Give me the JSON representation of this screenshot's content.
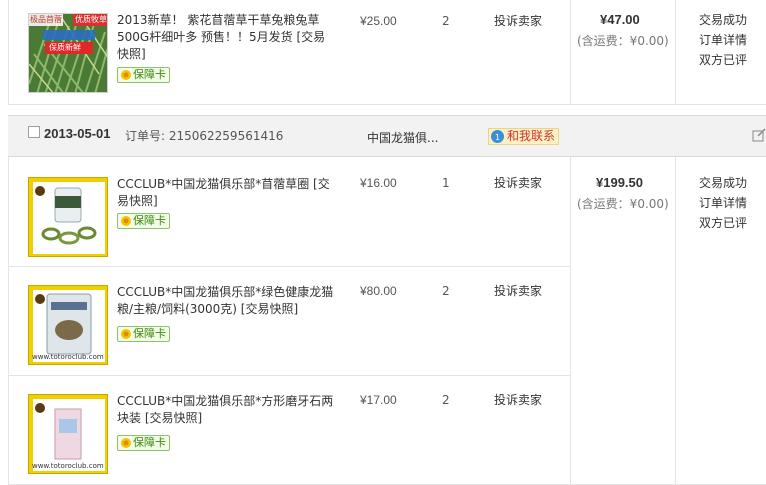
{
  "orders": [
    {
      "items": [
        {
          "title": "2013新草！ 紫花苜蓿草干草兔粮兔草500G杆细叶多 预售！！5月发货 [交易快照]",
          "image_text": [
            "极品苜蓿",
            "优质牧草",
            "保质新鲜"
          ],
          "badge": "保障卡",
          "price": "¥25.00",
          "qty": "2",
          "complain": "投诉卖家"
        }
      ],
      "total": "¥47.00",
      "shipping": "(含运费：¥0.00)",
      "status": [
        "交易成功",
        "订单详情",
        "双方已评"
      ]
    },
    {
      "header": {
        "date": "2013-05-01",
        "order_label": "订单号: 215062259561416",
        "seller": "中国龙猫俱...",
        "contact": "和我联系"
      },
      "items": [
        {
          "title": "CCCLUB*中国龙猫俱乐部*苜蓿草圈 [交易快照]",
          "badge": "保障卡",
          "price": "¥16.00",
          "qty": "1",
          "complain": "投诉卖家"
        },
        {
          "title": "CCCLUB*中国龙猫俱乐部*绿色健康龙猫粮/主粮/饲料(3000克) [交易快照]",
          "badge": "保障卡",
          "price": "¥80.00",
          "qty": "2",
          "complain": "投诉卖家"
        },
        {
          "title": "CCCLUB*中国龙猫俱乐部*方形磨牙石两块装 [交易快照]",
          "badge": "保障卡",
          "price": "¥17.00",
          "qty": "2",
          "complain": "投诉卖家"
        }
      ],
      "total": "¥199.50",
      "shipping": "(含运费：¥0.00)",
      "status": [
        "交易成功",
        "订单详情",
        "双方已评"
      ]
    }
  ],
  "watermark": "www.totoroclub.com"
}
